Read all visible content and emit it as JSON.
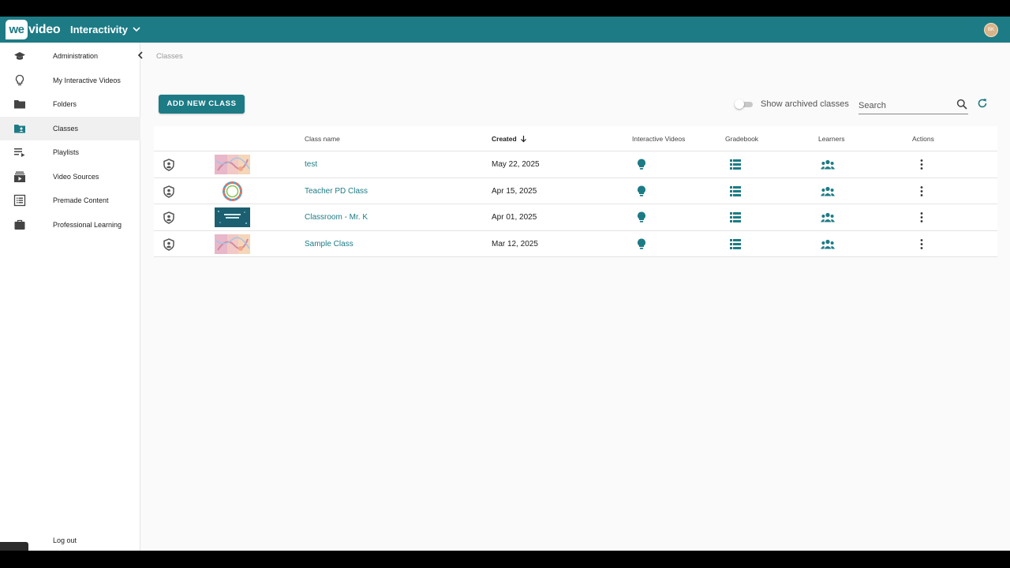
{
  "header": {
    "logo_we": "we",
    "logo_video": "video",
    "app_name": "Interactivity",
    "avatar_initials": "BK",
    "brand_color": "#1d7b85"
  },
  "sidebar": {
    "items": [
      {
        "label": "Administration",
        "icon": "graduation-cap-icon"
      },
      {
        "label": "My Interactive Videos",
        "icon": "lightbulb-outline-icon"
      },
      {
        "label": "Folders",
        "icon": "folder-icon"
      },
      {
        "label": "Classes",
        "icon": "class-badge-icon",
        "active": true
      },
      {
        "label": "Playlists",
        "icon": "playlist-icon"
      },
      {
        "label": "Video Sources",
        "icon": "video-library-icon"
      },
      {
        "label": "Premade Content",
        "icon": "list-document-icon"
      },
      {
        "label": "Professional Learning",
        "icon": "briefcase-icon"
      }
    ],
    "logout_label": "Log out"
  },
  "main": {
    "breadcrumb": "Classes",
    "add_button_label": "ADD NEW CLASS",
    "archived_toggle_label": "Show archived classes",
    "archived_toggle_on": false,
    "search_placeholder": "Search"
  },
  "table": {
    "columns": [
      "Class name",
      "Created",
      "Interactive Videos",
      "Gradebook",
      "Learners",
      "Actions"
    ],
    "sort_column": "Created",
    "sort_direction": "descending",
    "rows": [
      {
        "name": "test",
        "created": "May 22, 2025",
        "thumbnail": "pastel-doodle"
      },
      {
        "name": "Teacher PD Class",
        "created": "Apr 15, 2025",
        "thumbnail": "circle-of-people"
      },
      {
        "name": "Classroom - Mr. K",
        "created": "Apr 01, 2025",
        "thumbnail": "teal-banner"
      },
      {
        "name": "Sample Class",
        "created": "Mar 12, 2025",
        "thumbnail": "pastel-doodle"
      }
    ]
  }
}
